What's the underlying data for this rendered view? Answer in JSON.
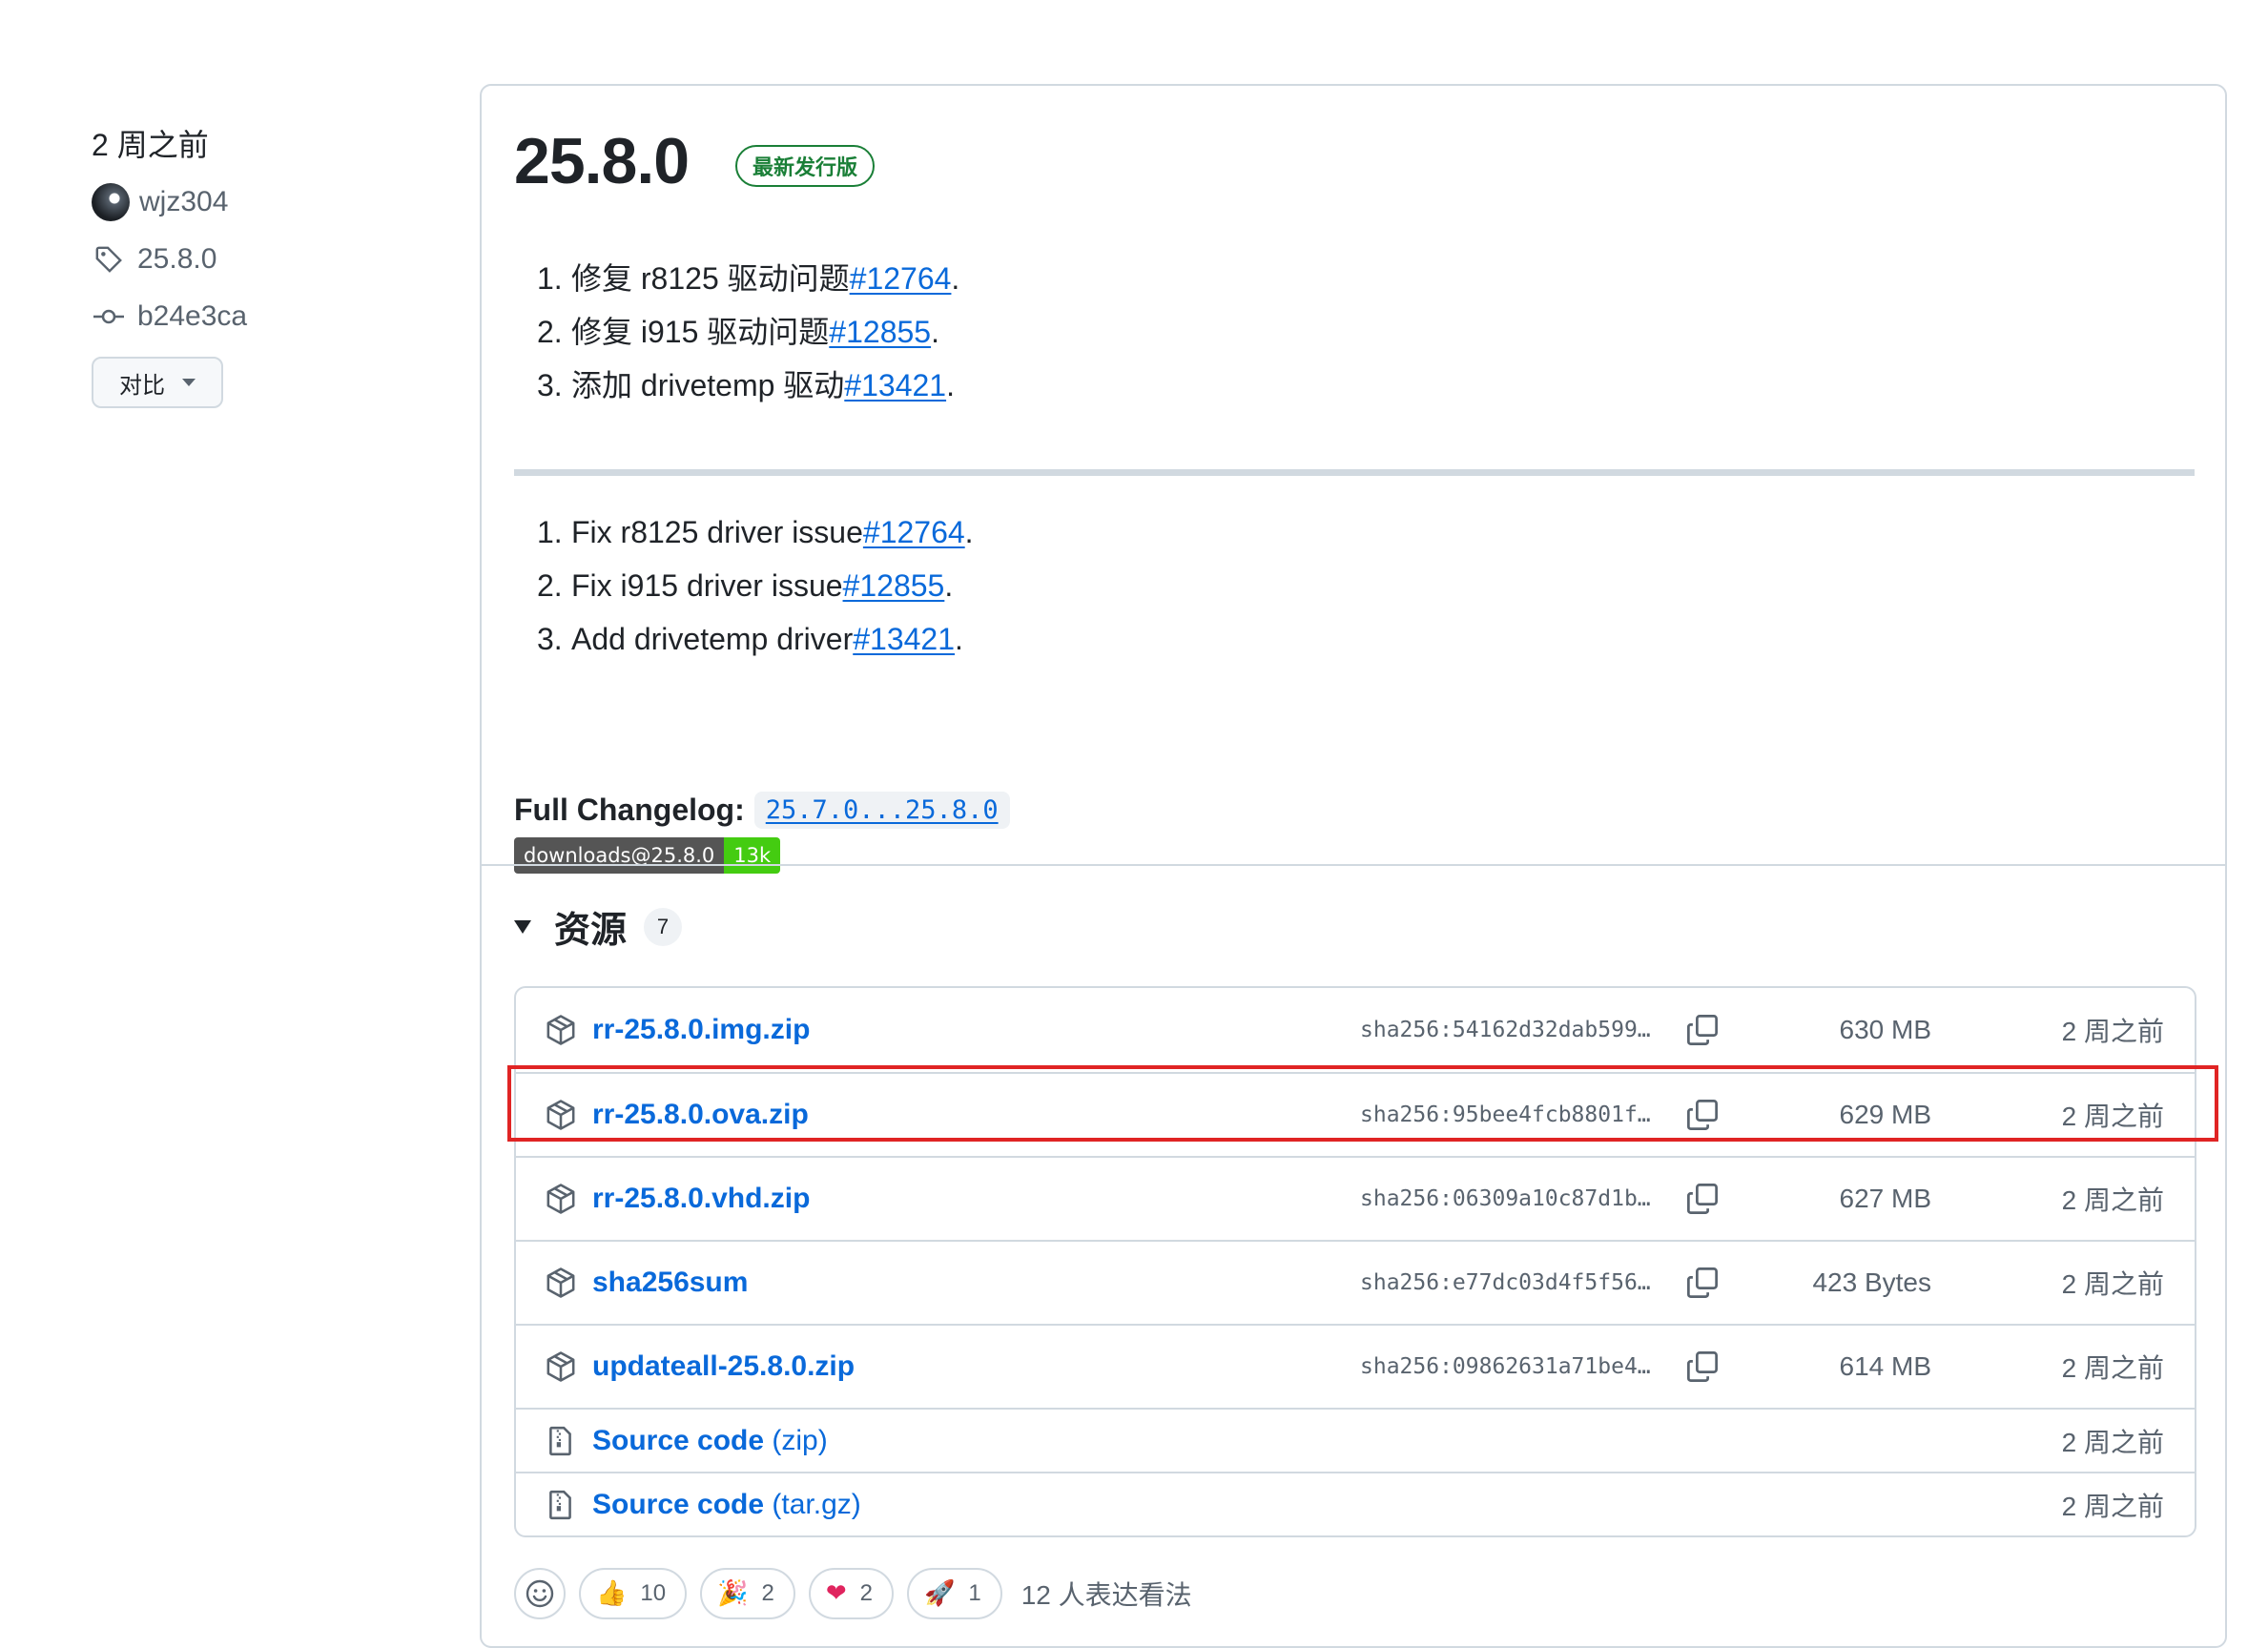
{
  "sidebar": {
    "time": "2 周之前",
    "author": "wjz304",
    "tag": "25.8.0",
    "commit": "b24e3ca",
    "compare_label": "对比"
  },
  "release": {
    "title": "25.8.0",
    "latest_label": "最新发行版",
    "notes_zh": [
      {
        "num": "1.",
        "text": "修复 r8125 驱动问题 ",
        "link": "#12764"
      },
      {
        "num": "2.",
        "text": "修复 i915 驱动问题 ",
        "link": "#12855"
      },
      {
        "num": "3.",
        "text": "添加 drivetemp 驱动 ",
        "link": "#13421"
      }
    ],
    "notes_en": [
      {
        "num": "1.",
        "text": "Fix r8125 driver issue ",
        "link": "#12764"
      },
      {
        "num": "2.",
        "text": "Fix i915 driver issue ",
        "link": "#12855"
      },
      {
        "num": "3.",
        "text": "Add drivetemp driver ",
        "link": "#13421"
      }
    ],
    "period": ".",
    "changelog_label": "Full Changelog:",
    "changelog_range": "25.7.0...25.8.0",
    "badge_left": "downloads@25.8.0",
    "badge_right": "13k"
  },
  "assets": {
    "title": "资源",
    "count": "7",
    "items": [
      {
        "name": "rr-25.8.0.img.zip",
        "sha": "sha256:54162d32dab599…",
        "size": "630 MB",
        "time": "2 周之前"
      },
      {
        "name": "rr-25.8.0.ova.zip",
        "sha": "sha256:95bee4fcb8801f…",
        "size": "629 MB",
        "time": "2 周之前"
      },
      {
        "name": "rr-25.8.0.vhd.zip",
        "sha": "sha256:06309a10c87d1b…",
        "size": "627 MB",
        "time": "2 周之前"
      },
      {
        "name": "sha256sum",
        "sha": "sha256:e77dc03d4f5f56…",
        "size": "423 Bytes",
        "time": "2 周之前"
      },
      {
        "name": "updateall-25.8.0.zip",
        "sha": "sha256:09862631a71be4…",
        "size": "614 MB",
        "time": "2 周之前"
      }
    ],
    "source": [
      {
        "name": "Source code",
        "fmt": " (zip)",
        "time": "2 周之前"
      },
      {
        "name": "Source code",
        "fmt": " (tar.gz)",
        "time": "2 周之前"
      }
    ]
  },
  "reactions": {
    "items": [
      {
        "emoji": "👍",
        "count": "10",
        "icon": "thumbs-up"
      },
      {
        "emoji": "🎉",
        "count": "2",
        "icon": "party-popper"
      },
      {
        "emoji": "❤",
        "count": "2",
        "icon": "heart"
      },
      {
        "emoji": "🚀",
        "count": "1",
        "icon": "rocket"
      }
    ],
    "summary": "12 人表达看法"
  },
  "colors": {
    "link": "#0969da",
    "latest_green": "#1a7f37",
    "highlight_red": "#e02424",
    "border": "#d1d9e0"
  }
}
